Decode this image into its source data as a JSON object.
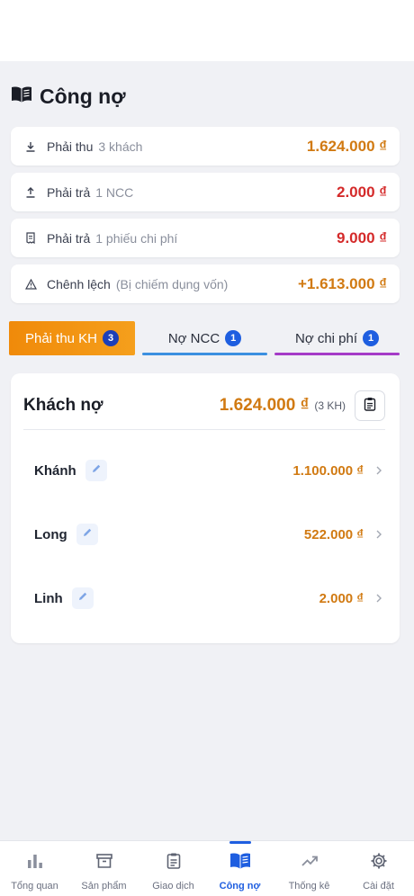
{
  "page": {
    "title": "Công nợ"
  },
  "summary": [
    {
      "label": "Phải thu",
      "sub": "3 khách",
      "amount": "1.624.000 ₫",
      "icon": "download-icon"
    },
    {
      "label": "Phải trả",
      "sub": "1 NCC",
      "amount": "2.000 ₫",
      "icon": "upload-icon"
    },
    {
      "label": "Phải trả",
      "sub": "1 phiếu chi phí",
      "amount": "9.000 ₫",
      "icon": "receipt-icon"
    },
    {
      "label": "Chênh lệch",
      "sub": "(Bị chiếm dụng vốn)",
      "amount": "+1.613.000 ₫",
      "icon": "warning-icon"
    }
  ],
  "tabs": [
    {
      "label": "Phải thu KH",
      "badge": "3",
      "active": true
    },
    {
      "label": "Nợ NCC",
      "badge": "1",
      "underline_color": "#3b8fe0"
    },
    {
      "label": "Nợ chi phí",
      "badge": "1",
      "underline_color": "#a53bc7"
    }
  ],
  "debt": {
    "title": "Khách nợ",
    "total": "1.624.000 ₫",
    "count": "(3 KH)",
    "rows": [
      {
        "name": "Khánh",
        "amount": "1.100.000 ₫"
      },
      {
        "name": "Long",
        "amount": "522.000 ₫"
      },
      {
        "name": "Linh",
        "amount": "2.000 ₫"
      }
    ]
  },
  "nav": [
    {
      "label": "Tổng quan",
      "icon": "bar-chart-icon"
    },
    {
      "label": "Sản phẩm",
      "icon": "archive-box-icon"
    },
    {
      "label": "Giao dịch",
      "icon": "clipboard-icon"
    },
    {
      "label": "Công nợ",
      "icon": "open-book-icon",
      "active": true
    },
    {
      "label": "Thống kê",
      "icon": "trend-up-icon"
    },
    {
      "label": "Cài đặt",
      "icon": "gear-icon"
    }
  ],
  "colors": {
    "accent": "#1e5ee0",
    "orange": "#d17a12",
    "red": "#d42a2a",
    "tab_active": "#f08a0a"
  }
}
